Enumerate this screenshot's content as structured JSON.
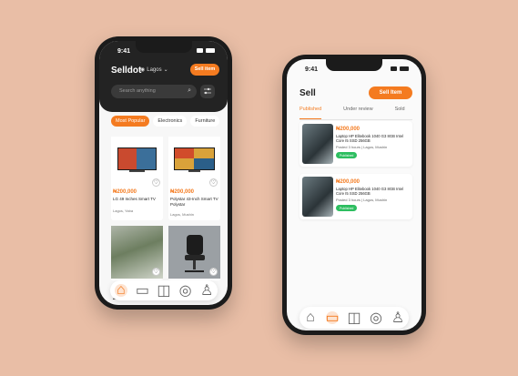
{
  "marketplace": {
    "status_time": "9:41",
    "logo": "Selldot",
    "location": "Lagos",
    "sell_button": "Sell item",
    "search_placeholder": "Search anything",
    "chips": [
      "Most Popular",
      "Electronics",
      "Furniture"
    ],
    "products": [
      {
        "price": "₦200,000",
        "title": "LG 49 Inches Smart TV",
        "location": "Lagos, Yaba"
      },
      {
        "price": "₦200,000",
        "title": "Polystar 43-Inch Smart TV Polystar",
        "location": "Lagos, Mushin"
      },
      {
        "price": "",
        "title": "",
        "location": ""
      },
      {
        "price": "",
        "title": "",
        "location": ""
      }
    ],
    "partial_text": "25dar",
    "tabbar": [
      "home-icon",
      "wallet-icon",
      "bag-icon",
      "tag-icon",
      "user-icon"
    ]
  },
  "sell": {
    "status_time": "9:41",
    "title": "Sell",
    "sell_button": "Sell Item",
    "tabs": [
      "Published",
      "Under review",
      "Sold"
    ],
    "listings": [
      {
        "price": "₦200,000",
        "title": "Laptop HP Elitebook 1040 G3 8GB Intel Core I5 SSD 256GB",
        "meta": "Posted 3 hours  |  Lagos, Mushin",
        "badge": "Published"
      },
      {
        "price": "₦200,000",
        "title": "Laptop HP Elitebook 1040 G3 8GB Intel Core I5 SSD 256GB",
        "meta": "Posted 3 hours  |  Lagos, Mushin",
        "badge": "Published"
      }
    ],
    "tabbar": [
      "home-icon",
      "wallet-icon",
      "bag-icon",
      "tag-icon",
      "user-icon"
    ]
  },
  "colors": {
    "accent": "#F47B20",
    "background": "#E9BEA6",
    "badge": "#2DBE60"
  }
}
